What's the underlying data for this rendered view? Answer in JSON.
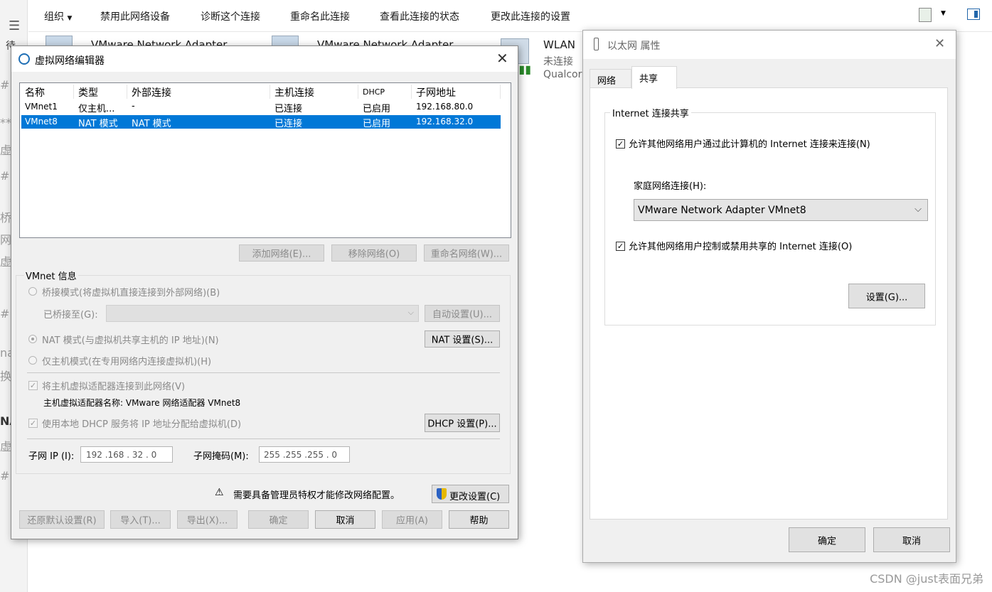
{
  "explorer": {
    "toolbar": {
      "organize": "组织",
      "disable": "禁用此网络设备",
      "diagnose": "诊断这个连接",
      "rename": "重命名此连接",
      "status": "查看此连接的状态",
      "settings": "更改此连接的设置"
    },
    "adapters": [
      {
        "name": "VMware Network Adapter"
      },
      {
        "name": "VMware Network Adapter"
      },
      {
        "name": "WLAN",
        "status": "未连接",
        "device": "Qualcor"
      }
    ]
  },
  "left_strip": {
    "chars": [
      "待",
      "#",
      "**",
      "虚",
      "#",
      "桥",
      "网",
      "虚",
      "#",
      "na",
      "换为",
      "NA",
      "虚",
      "#"
    ]
  },
  "vmware_editor": {
    "title": "虚拟网络编辑器",
    "columns": [
      "名称",
      "类型",
      "外部连接",
      "主机连接",
      "DHCP",
      "子网地址"
    ],
    "rows": [
      {
        "name": "VMnet1",
        "type": "仅主机...",
        "external": "-",
        "host": "已连接",
        "dhcp": "已启用",
        "subnet": "192.168.80.0"
      },
      {
        "name": "VMnet8",
        "type": "NAT 模式",
        "external": "NAT 模式",
        "host": "已连接",
        "dhcp": "已启用",
        "subnet": "192.168.32.0"
      }
    ],
    "buttons": {
      "add": "添加网络(E)...",
      "remove": "移除网络(O)",
      "rename": "重命名网络(W)...",
      "auto": "自动设置(U)...",
      "nat": "NAT 设置(S)...",
      "dhcp": "DHCP 设置(P)...",
      "change": "更改设置(C)",
      "restore": "还原默认设置(R)",
      "import": "导入(T)...",
      "export": "导出(X)...",
      "ok": "确定",
      "cancel": "取消",
      "apply": "应用(A)",
      "help": "帮助"
    },
    "info": {
      "legend": "VMnet 信息",
      "bridge": "桥接模式(将虚拟机直接连接到外部网络)(B)",
      "bridged_to": "已桥接至(G):",
      "nat": "NAT 模式(与虚拟机共享主机的 IP 地址)(N)",
      "host_only": "仅主机模式(在专用网络内连接虚拟机)(H)",
      "connect_adapter": "将主机虚拟适配器连接到此网络(V)",
      "adapter_name": "主机虚拟适配器名称: VMware 网络适配器 VMnet8",
      "use_dhcp": "使用本地 DHCP 服务将 IP 地址分配给虚拟机(D)",
      "subnet_ip_label": "子网 IP (I):",
      "subnet_ip": "192 .168 . 32 . 0",
      "mask_label": "子网掩码(M):",
      "mask": "255 .255 .255 . 0"
    },
    "admin_note": "需要具备管理员特权才能修改网络配置。"
  },
  "ethernet_props": {
    "title": "以太网 属性",
    "tabs": [
      "网络",
      "共享"
    ],
    "group": "Internet 连接共享",
    "allow_share": "允许其他网络用户通过此计算机的 Internet 连接来连接(N)",
    "home_label": "家庭网络连接(H):",
    "home_value": "VMware Network Adapter VMnet8",
    "allow_control": "允许其他网络用户控制或禁用共享的 Internet 连接(O)",
    "settings_btn": "设置(G)...",
    "ok": "确定",
    "cancel": "取消"
  },
  "watermark": "CSDN @just表面兄弟",
  "colors": {
    "selection": "#0078d7",
    "dialog_bg": "#f0f0f0"
  }
}
